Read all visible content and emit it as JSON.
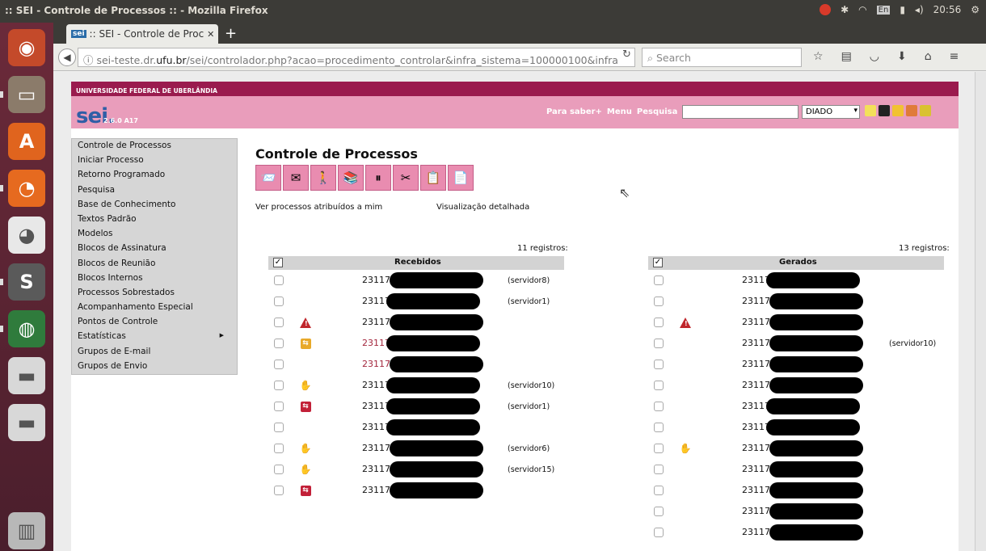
{
  "os": {
    "window_title": ":: SEI - Controle de Processos :: - Mozilla Firefox",
    "keyboard_layout": "En",
    "clock": "20:56"
  },
  "launcher": {
    "apps": [
      {
        "name": "dash-icon",
        "color": "#c44a2a",
        "glyph": "◉"
      },
      {
        "name": "files-icon",
        "color": "#8b7b6a",
        "glyph": "▭"
      },
      {
        "name": "software-center-icon",
        "color": "#e0641e",
        "glyph": "A"
      },
      {
        "name": "firefox-icon",
        "color": "#e66a1f",
        "glyph": "◔"
      },
      {
        "name": "disk-icon",
        "color": "#e8e8e8",
        "glyph": "◕"
      },
      {
        "name": "sublime-icon",
        "color": "#5a5a5a",
        "glyph": "S"
      },
      {
        "name": "globe-icon",
        "color": "#2f7b3c",
        "glyph": "◍"
      },
      {
        "name": "drive-icon",
        "color": "#d8d8d8",
        "glyph": "▬"
      },
      {
        "name": "drive2-icon",
        "color": "#d8d8d8",
        "glyph": "▬"
      },
      {
        "name": "trash-icon",
        "color": "#b8b8b8",
        "glyph": "▥"
      }
    ]
  },
  "browser": {
    "tab_favicon": "sei",
    "tab_title": ":: SEI - Controle de Proc",
    "url_prefix": "sei-teste.dr.",
    "url_domain": "ufu.br",
    "url_rest": "/sei/controlador.php?acao=procedimento_controlar&infra_sistema=100000100&infra",
    "search_placeholder": "Search"
  },
  "sei": {
    "university": "UNIVERSIDADE FEDERAL DE UBERLÂNDIA",
    "logo": "sei.",
    "version": "2.6.0 A17",
    "header_links": [
      "Para saber+",
      "Menu",
      "Pesquisa"
    ],
    "unit_select": "DIADO",
    "header_icon_colors": [
      "#f3e05a",
      "#222222",
      "#f1c232",
      "#e07b39",
      "#d9c231"
    ],
    "menu": [
      "Controle de Processos",
      "Iniciar Processo",
      "Retorno Programado",
      "Pesquisa",
      "Base de Conhecimento",
      "Textos Padrão",
      "Modelos",
      "Blocos de Assinatura",
      "Blocos de Reunião",
      "Blocos Internos",
      "Processos Sobrestados",
      "Acompanhamento Especial",
      "Pontos de Controle",
      "Estatísticas",
      "Grupos de E-mail",
      "Grupos de Envio"
    ],
    "page_title": "Controle de Processos",
    "toolbar_icons": [
      "📨",
      "✉",
      "🚶",
      "📚",
      "⏸",
      "✂",
      "📋",
      "📄"
    ],
    "link_mine": "Ver processos atribuídos a mim",
    "link_detail": "Visualização detalhada",
    "received": {
      "count": "11 registros:",
      "title": "Recebidos",
      "rows": [
        {
          "num": "23117.",
          "icon": "",
          "user": "(servidor8)",
          "red": false
        },
        {
          "num": "23117",
          "icon": "",
          "user": "(servidor1)",
          "red": false
        },
        {
          "num": "23117.",
          "icon": "alert",
          "user": "",
          "red": false
        },
        {
          "num": "23117",
          "icon": "yellow",
          "user": "",
          "red": true
        },
        {
          "num": "23117.",
          "icon": "",
          "user": "",
          "red": true
        },
        {
          "num": "23117",
          "icon": "hand",
          "user": "(servidor10)",
          "red": false
        },
        {
          "num": "23117",
          "icon": "redbox",
          "user": "(servidor1)",
          "red": false
        },
        {
          "num": "23117",
          "icon": "",
          "user": "",
          "red": false
        },
        {
          "num": "23117.",
          "icon": "hand",
          "user": "(servidor6)",
          "red": false
        },
        {
          "num": "23117.",
          "icon": "hand",
          "user": "(servidor15)",
          "red": false
        },
        {
          "num": "23117.",
          "icon": "redbox",
          "user": "",
          "red": false
        }
      ]
    },
    "generated": {
      "count": "13 registros:",
      "title": "Gerados",
      "rows": [
        {
          "num": "23117",
          "icon": "",
          "user": ""
        },
        {
          "num": "23117.",
          "icon": "",
          "user": ""
        },
        {
          "num": "23117.",
          "icon": "alert",
          "user": ""
        },
        {
          "num": "23117.",
          "icon": "",
          "user": "(servidor10)"
        },
        {
          "num": "23117.",
          "icon": "",
          "user": ""
        },
        {
          "num": "23117.",
          "icon": "",
          "user": ""
        },
        {
          "num": "23117",
          "icon": "",
          "user": ""
        },
        {
          "num": "23117",
          "icon": "",
          "user": ""
        },
        {
          "num": "23117.",
          "icon": "bat",
          "user": ""
        },
        {
          "num": "23117.",
          "icon": "",
          "user": ""
        },
        {
          "num": "23117.",
          "icon": "",
          "user": ""
        },
        {
          "num": "23117.",
          "icon": "",
          "user": ""
        },
        {
          "num": "23117.",
          "icon": "",
          "user": ""
        }
      ]
    }
  }
}
